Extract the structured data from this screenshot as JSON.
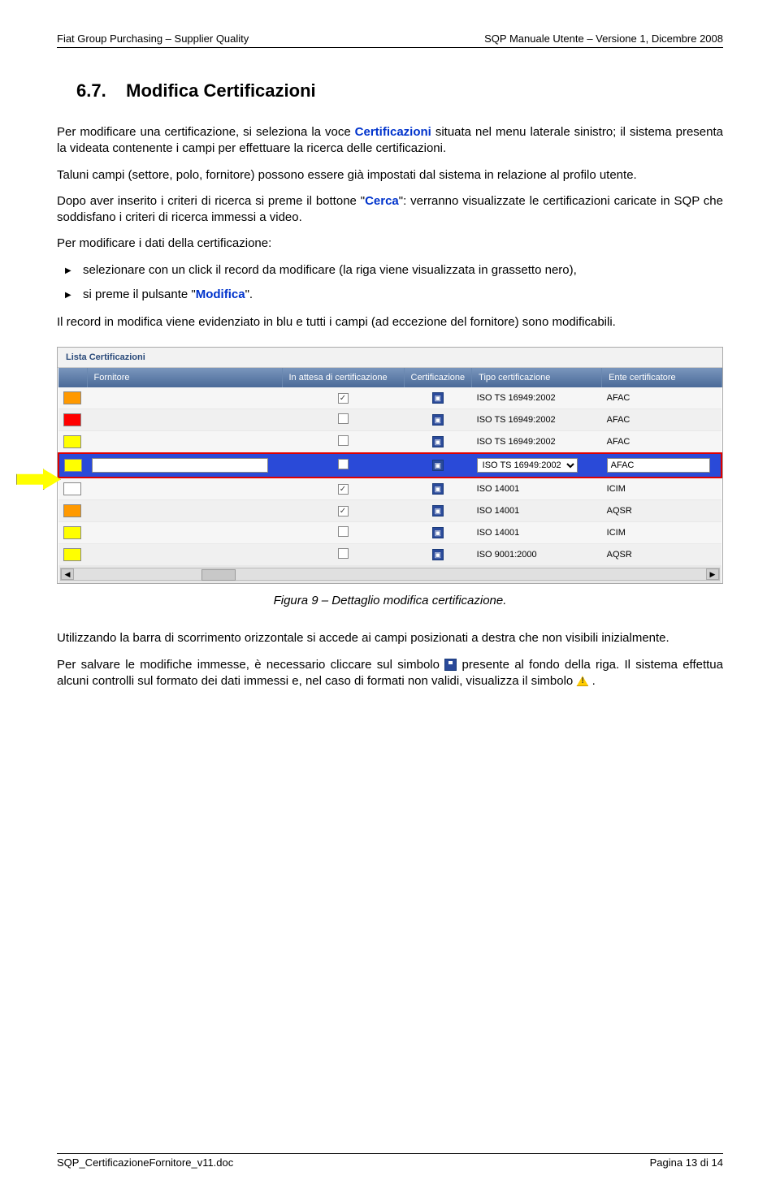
{
  "header": {
    "left": "Fiat Group Purchasing – Supplier Quality",
    "right": "SQP Manuale Utente – Versione 1, Dicembre 2008"
  },
  "section": {
    "number": "6.7.",
    "title": "Modifica Certificazioni"
  },
  "body": {
    "p1a": "Per modificare una certificazione, si seleziona la voce ",
    "p1b": "Certificazioni",
    "p1c": " situata nel menu laterale sinistro; il sistema presenta la videata contenente i campi per effettuare la ricerca delle certificazioni.",
    "p2": "Taluni campi (settore, polo, fornitore) possono essere già impostati dal sistema in relazione al profilo utente.",
    "p3a": "Dopo aver inserito i criteri di ricerca si preme il bottone \"",
    "p3b": "Cerca",
    "p3c": "\": verranno visualizzate le certificazioni caricate in SQP che soddisfano i criteri di ricerca immessi a video.",
    "p4": "Per modificare i dati della certificazione:",
    "li1": "selezionare con un click il record da modificare (la riga viene visualizzata in grassetto nero),",
    "li2a": "si preme il pulsante \"",
    "li2b": "Modifica",
    "li2c": "\".",
    "p5": "Il record in modifica viene evidenziato in blu e tutti i campi (ad eccezione del fornitore) sono modificabili.",
    "p6": "Utilizzando la barra di scorrimento orizzontale si accede ai campi posizionati a destra che non visibili inizialmente.",
    "p7a": "Per salvare le modifiche immesse, è necessario cliccare sul simbolo ",
    "p7b": " presente      al fondo della riga. Il sistema effettua alcuni controlli sul formato dei dati immessi e, nel caso di formati non validi, visualizza il simbolo ",
    "p7c": " ."
  },
  "figure": {
    "title": "Lista Certificazioni",
    "caption": "Figura 9 – Dettaglio modifica certificazione.",
    "headers": {
      "fornitore": "Fornitore",
      "attesa": "In attesa di certificazione",
      "certif": "Certificazione",
      "tipo": "Tipo certificazione",
      "ente": "Ente certificatore"
    },
    "rows": [
      {
        "color": "orange",
        "checked": true,
        "tipo": "ISO TS 16949:2002",
        "ente": "AFAC"
      },
      {
        "color": "red",
        "checked": false,
        "tipo": "ISO TS 16949:2002",
        "ente": "AFAC"
      },
      {
        "color": "yellow",
        "checked": false,
        "tipo": "ISO TS 16949:2002",
        "ente": "AFAC"
      },
      {
        "color": "yellow",
        "checked": false,
        "tipo": "ISO TS 16949:2002",
        "ente": "AFAC",
        "selected": true
      },
      {
        "color": "white",
        "checked": true,
        "tipo": "ISO 14001",
        "ente": "ICIM"
      },
      {
        "color": "orange",
        "checked": true,
        "tipo": "ISO 14001",
        "ente": "AQSR"
      },
      {
        "color": "yellow",
        "checked": false,
        "tipo": "ISO 14001",
        "ente": "ICIM"
      },
      {
        "color": "yellow",
        "checked": false,
        "tipo": "ISO 9001:2000",
        "ente": "AQSR"
      }
    ]
  },
  "footer": {
    "left": "SQP_CertificazioneFornitore_v11.doc",
    "right": "Pagina 13 di 14"
  }
}
